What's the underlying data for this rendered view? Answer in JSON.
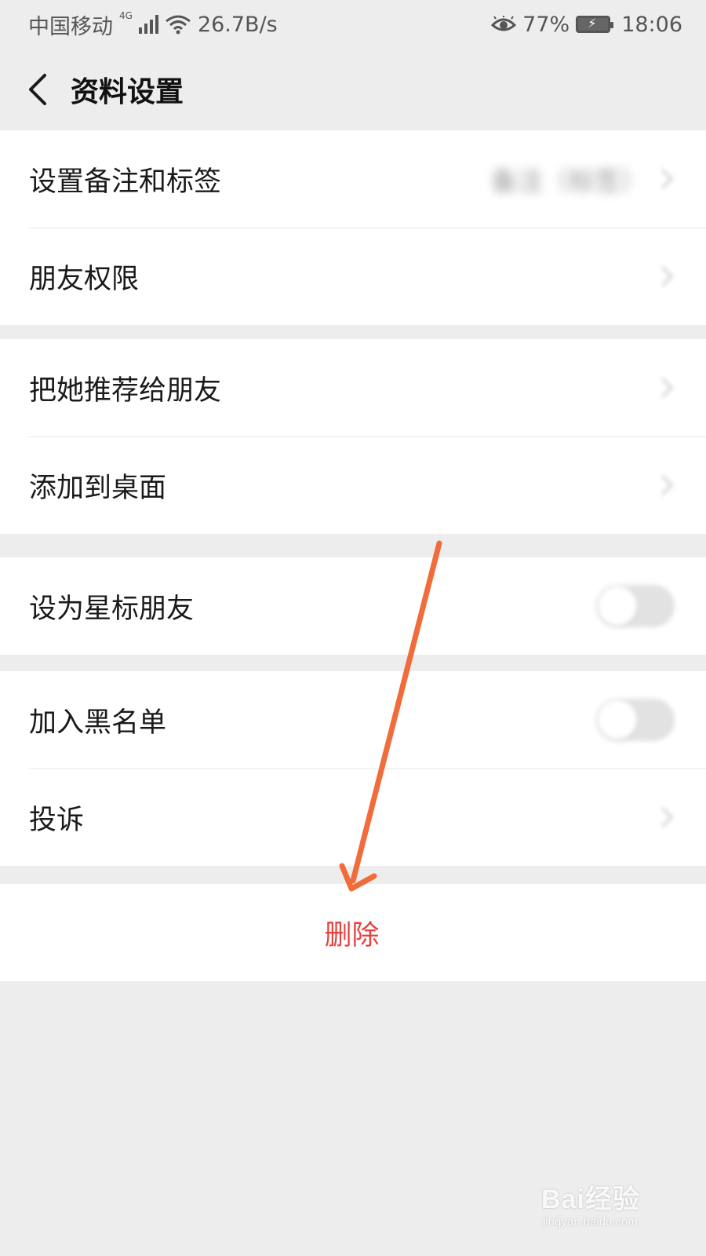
{
  "status_bar": {
    "carrier": "中国移动",
    "network_type": "4G",
    "speed": "26.7B/s",
    "battery": "77%",
    "time": "18:06"
  },
  "header": {
    "title": "资料设置"
  },
  "groups": [
    {
      "rows": [
        {
          "label": "设置备注和标签",
          "value": "备注（标签）",
          "control": "chevron"
        },
        {
          "label": "朋友权限",
          "control": "chevron"
        }
      ]
    },
    {
      "rows": [
        {
          "label": "把她推荐给朋友",
          "control": "chevron"
        },
        {
          "label": "添加到桌面",
          "control": "chevron"
        }
      ]
    },
    {
      "rows": [
        {
          "label": "设为星标朋友",
          "control": "toggle",
          "on": false
        }
      ]
    },
    {
      "rows": [
        {
          "label": "加入黑名单",
          "control": "toggle",
          "on": false
        },
        {
          "label": "投诉",
          "control": "chevron"
        }
      ]
    }
  ],
  "delete": {
    "label": "删除",
    "color": "#e64340"
  },
  "annotation": {
    "type": "arrow",
    "color": "#f26b3a",
    "points_to": "删除"
  },
  "watermark": {
    "brand": "Bai经验",
    "url": "jingyan.baidu.com"
  }
}
